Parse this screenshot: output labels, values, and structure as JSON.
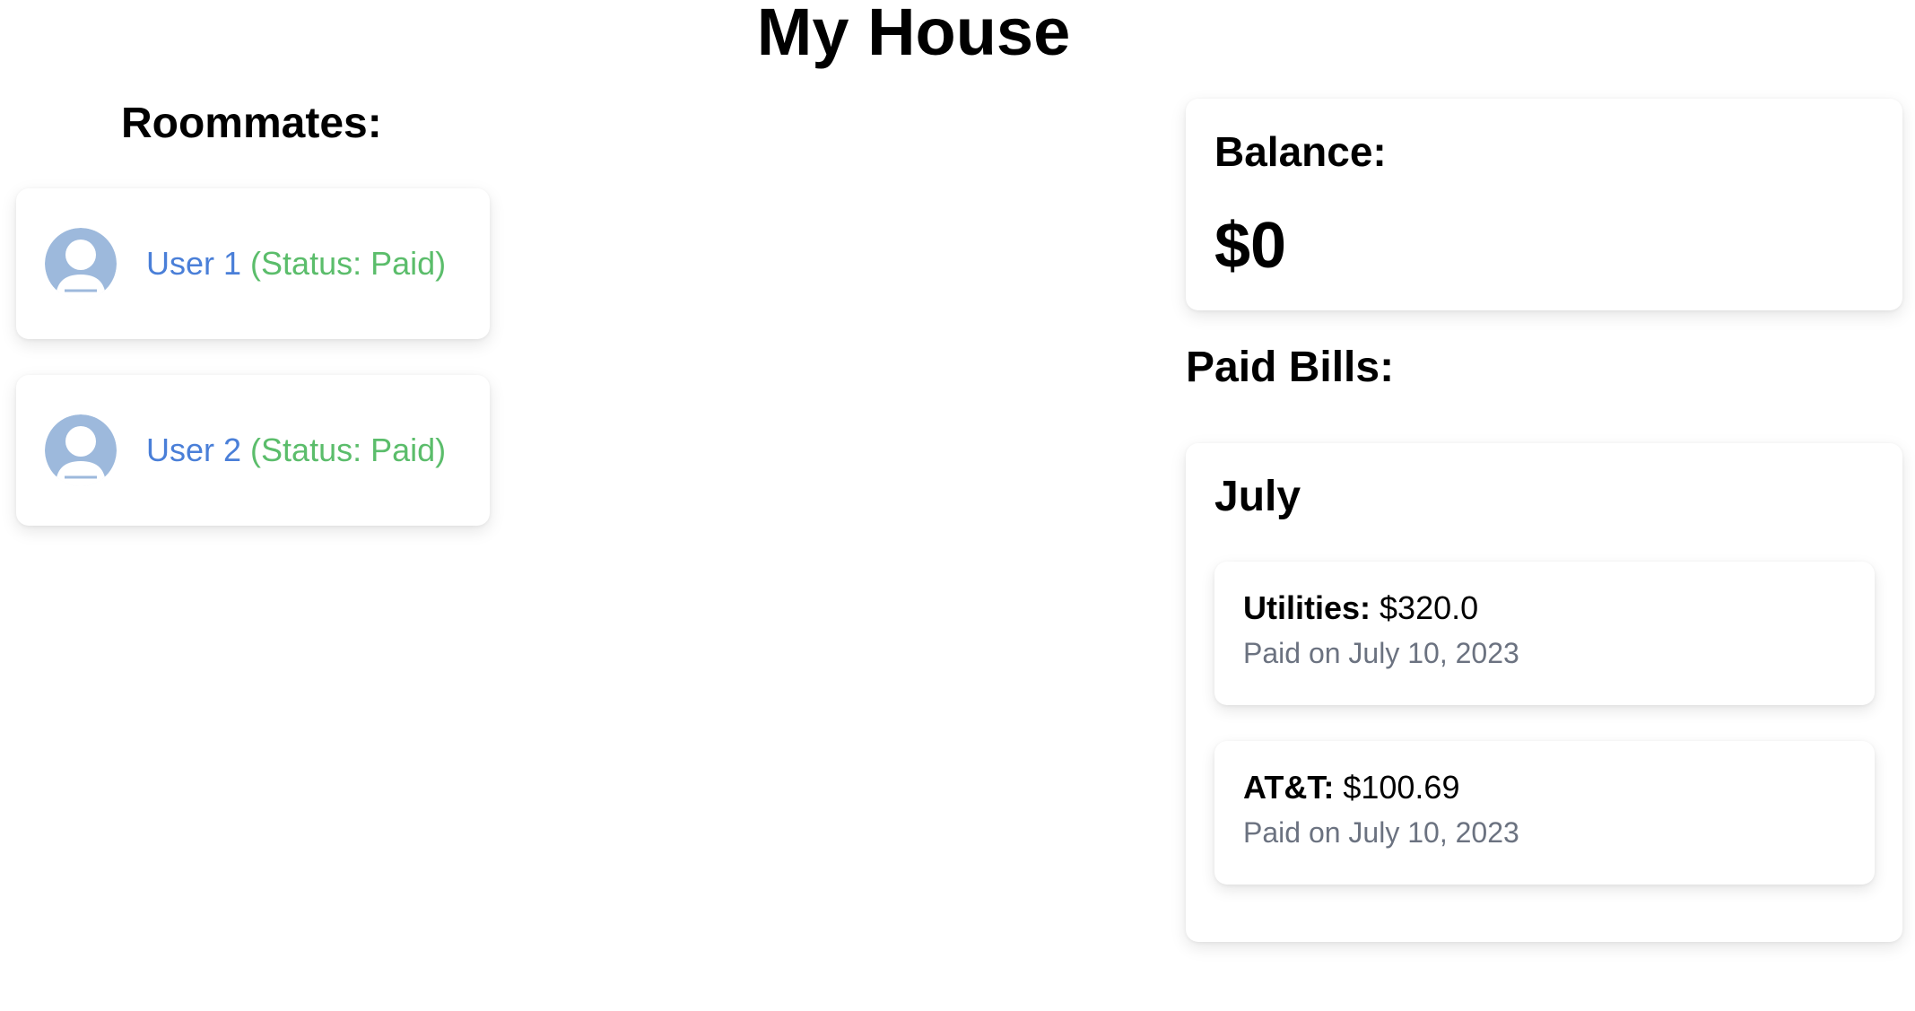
{
  "page": {
    "title": "My House"
  },
  "roommates": {
    "heading": "Roommates:",
    "items": [
      {
        "name": "User 1",
        "status": "(Status: Paid)"
      },
      {
        "name": "User 2",
        "status": "(Status: Paid)"
      }
    ]
  },
  "balance": {
    "label": "Balance:",
    "value": "$0"
  },
  "paid_bills": {
    "heading": "Paid Bills:",
    "months": [
      {
        "month": "July",
        "bills": [
          {
            "name": "Utilities:",
            "amount": "$320.0",
            "date": "Paid on July 10, 2023"
          },
          {
            "name": "AT&T:",
            "amount": "$100.69",
            "date": "Paid on July 10, 2023"
          }
        ]
      }
    ]
  },
  "colors": {
    "user_name": "#4a7fd8",
    "status_paid": "#5bbd6b",
    "avatar": "#9db9dc",
    "muted_text": "#6b7280"
  },
  "icons": {
    "avatar": "user-avatar-icon"
  }
}
